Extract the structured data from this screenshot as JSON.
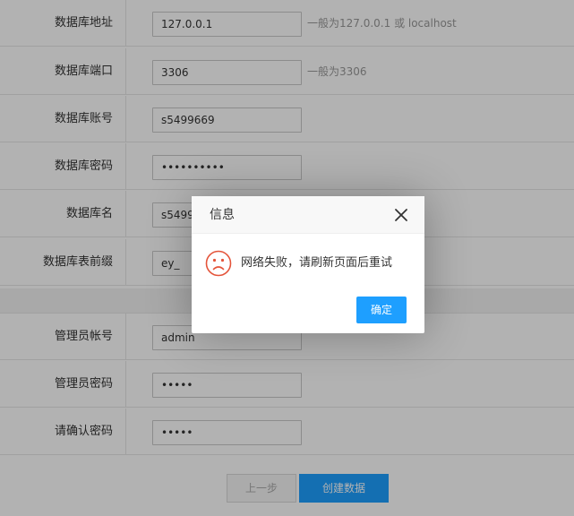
{
  "form": {
    "db_host": {
      "label": "数据库地址",
      "value": "127.0.0.1",
      "hint": "一般为127.0.0.1 或 localhost"
    },
    "db_port": {
      "label": "数据库端口",
      "value": "3306",
      "hint": "一般为3306"
    },
    "db_user": {
      "label": "数据库账号",
      "value": "s5499669"
    },
    "db_password": {
      "label": "数据库密码",
      "value": "••••••••••"
    },
    "db_name": {
      "label": "数据库名",
      "value": "s5499669"
    },
    "db_prefix": {
      "label": "数据库表前缀",
      "value": "ey_"
    },
    "admin_user": {
      "label": "管理员帐号",
      "value": "admin"
    },
    "admin_password": {
      "label": "管理员密码",
      "value": "•••••"
    },
    "admin_confirm": {
      "label": "请确认密码",
      "value": "•••••"
    }
  },
  "footer": {
    "prev_label": "上一步",
    "create_label": "创建数据"
  },
  "dialog": {
    "title": "信息",
    "message": "网络失败，请刷新页面后重试",
    "ok_label": "确定"
  },
  "colors": {
    "accent": "#1e9fff",
    "sad_face": "#e4543a"
  },
  "icons": {
    "close": "close-icon",
    "sad": "sad-face-icon"
  }
}
